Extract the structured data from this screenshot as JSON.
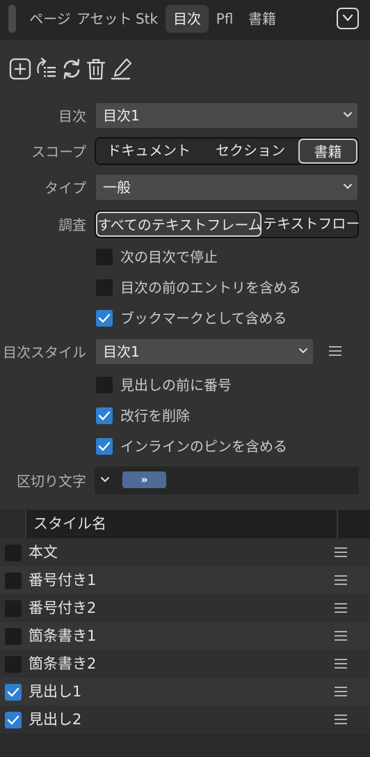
{
  "tabs": [
    {
      "label": "ページ",
      "active": false
    },
    {
      "label": "アセット",
      "active": false
    },
    {
      "label": "Stk",
      "active": false
    },
    {
      "label": "目次",
      "active": true
    },
    {
      "label": "Pfl",
      "active": false
    },
    {
      "label": "書籍",
      "active": false
    }
  ],
  "toolbar": {
    "icons": [
      "add-icon",
      "import-list-icon",
      "refresh-icon",
      "trash-icon",
      "edit-icon"
    ]
  },
  "form": {
    "toc_label": "目次",
    "toc_value": "目次1",
    "scope_label": "スコープ",
    "scope_options": [
      "ドキュメント",
      "セクション",
      "書籍"
    ],
    "scope_selected": "書籍",
    "type_label": "タイプ",
    "type_value": "一般",
    "search_label": "調査",
    "search_options": [
      "すべてのテキストフレーム",
      "テキストフロー"
    ],
    "search_selected": "すべてのテキストフレーム",
    "checks1": [
      {
        "label": "次の目次で停止",
        "checked": false
      },
      {
        "label": "目次の前のエントリを含める",
        "checked": false
      },
      {
        "label": "ブックマークとして含める",
        "checked": true
      }
    ],
    "toc_style_label": "目次スタイル",
    "toc_style_value": "目次1",
    "checks2": [
      {
        "label": "見出しの前に番号",
        "checked": false
      },
      {
        "label": "改行を削除",
        "checked": true
      },
      {
        "label": "インラインのピンを含める",
        "checked": true
      }
    ],
    "separator_label": "区切り文字",
    "separator_token": "»"
  },
  "table": {
    "header": "スタイル名",
    "rows": [
      {
        "name": "本文",
        "checked": false
      },
      {
        "name": "番号付き1",
        "checked": false
      },
      {
        "name": "番号付き2",
        "checked": false
      },
      {
        "name": "箇条書き1",
        "checked": false
      },
      {
        "name": "箇条書き2",
        "checked": false
      },
      {
        "name": "見出し1",
        "checked": true
      },
      {
        "name": "見出し2",
        "checked": true
      }
    ]
  },
  "colors": {
    "accent": "#2f7fd1",
    "token": "#4d6b94",
    "panel": "#323232"
  }
}
